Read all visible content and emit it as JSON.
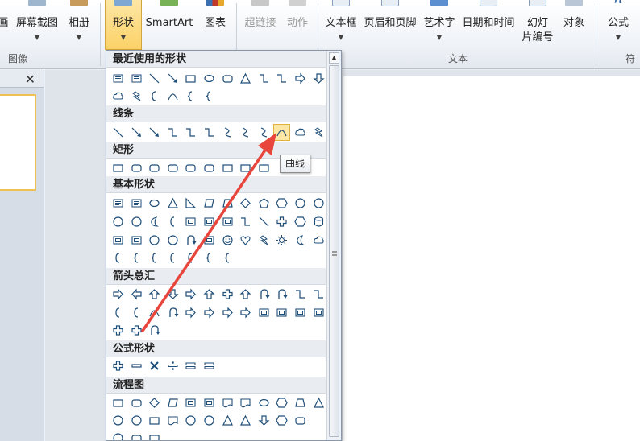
{
  "ribbon": {
    "buttons": {
      "picture": "画",
      "screenshot": "屏幕截图",
      "album": "相册",
      "shapes": "形状",
      "smartart": "SmartArt",
      "chart": "图表",
      "hyperlink": "超链接",
      "action": "动作",
      "textbox": "文本框",
      "header_footer": "页眉和页脚",
      "wordart": "艺术字",
      "datetime": "日期和时间",
      "slide_number_1": "幻灯",
      "slide_number_2": "片编号",
      "object": "对象",
      "formula": "公式"
    },
    "groups": {
      "images": "图像",
      "text": "文本",
      "symbols": "符"
    }
  },
  "shapes_dropdown": {
    "sections": {
      "recent": "最近使用的形状",
      "lines": "线条",
      "rectangles": "矩形",
      "basic": "基本形状",
      "arrows": "箭头总汇",
      "equation": "公式形状",
      "flowchart": "流程图"
    },
    "tooltip": "曲线"
  },
  "colors": {
    "accent": "#fbd268",
    "arrow": "#e8453c",
    "shape_stroke": "#1f4e79"
  }
}
